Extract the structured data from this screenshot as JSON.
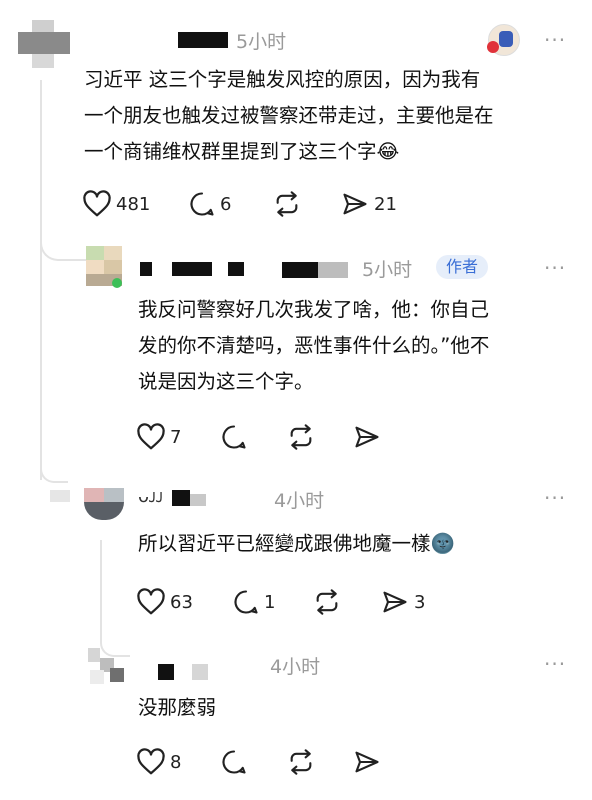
{
  "comments": [
    {
      "time": "5小时",
      "text_lines": [
        "习近平 这三个字是触发风控的原因，因为我有",
        "一个朋友也触发过被警察还带走过，主要他是在",
        "一个商铺维权群里提到了这三个字😂"
      ],
      "actions": {
        "likes": "481",
        "replies": "6",
        "reposts": "",
        "shares": "21"
      },
      "more": "···"
    },
    {
      "time": "5小时",
      "author_badge": "作者",
      "text_lines": [
        "我反问警察好几次我发了啥，他：你自己",
        "发的你不清楚吗，恶性事件什么的。”他不",
        "说是因为这三个字。"
      ],
      "actions": {
        "likes": "7",
        "replies": "",
        "reposts": "",
        "shares": ""
      },
      "more": "···"
    },
    {
      "time": "4小时",
      "text_lines": [
        "所以習近平已經變成跟佛地魔一樣🌚"
      ],
      "actions": {
        "likes": "63",
        "replies": "1",
        "reposts": "",
        "shares": "3"
      },
      "more": "···"
    },
    {
      "time": "4小时",
      "text_lines": [
        "没那麼弱"
      ],
      "actions": {
        "likes": "8",
        "replies": "",
        "reposts": "",
        "shares": ""
      },
      "more": "···"
    }
  ],
  "icons": {
    "like": "heart-icon",
    "reply": "comment-bubble-icon",
    "repost": "repost-icon",
    "share": "send-icon",
    "more": "more-dots-icon"
  }
}
